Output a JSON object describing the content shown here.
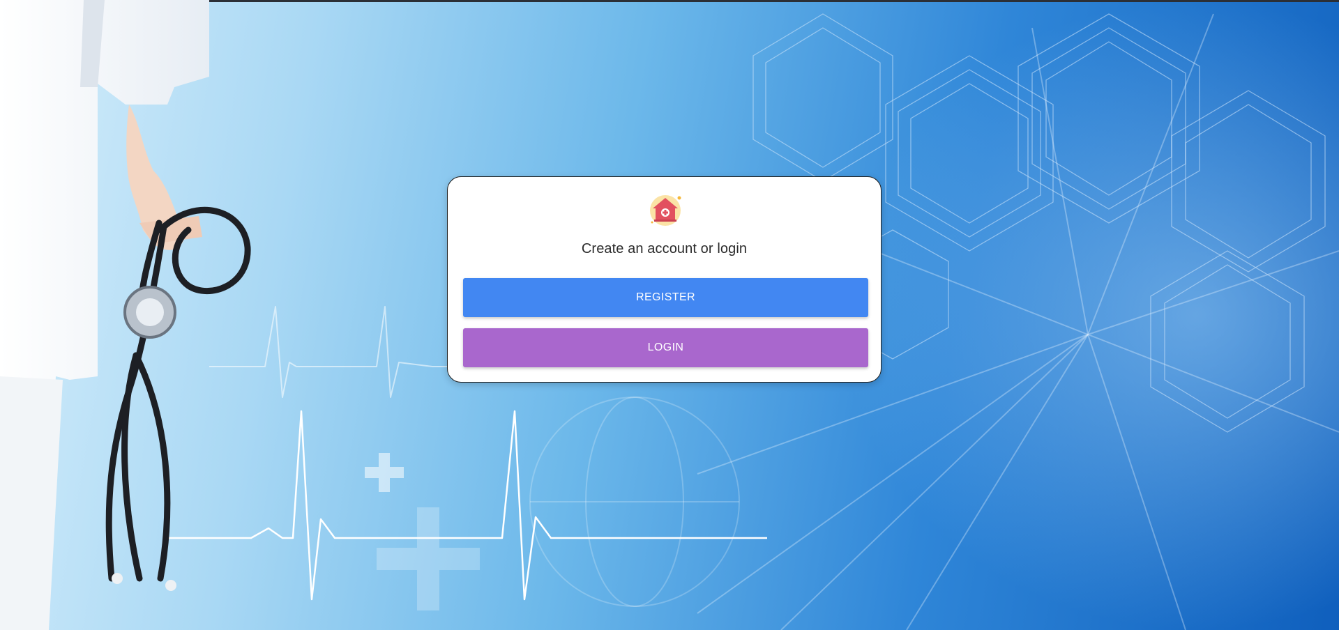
{
  "card": {
    "logo_icon": "medical-home-icon",
    "title": "Create an account or login",
    "register_label": "REGISTER",
    "login_label": "LOGIN"
  },
  "colors": {
    "register": "#4287f2",
    "login": "#a967cd"
  }
}
